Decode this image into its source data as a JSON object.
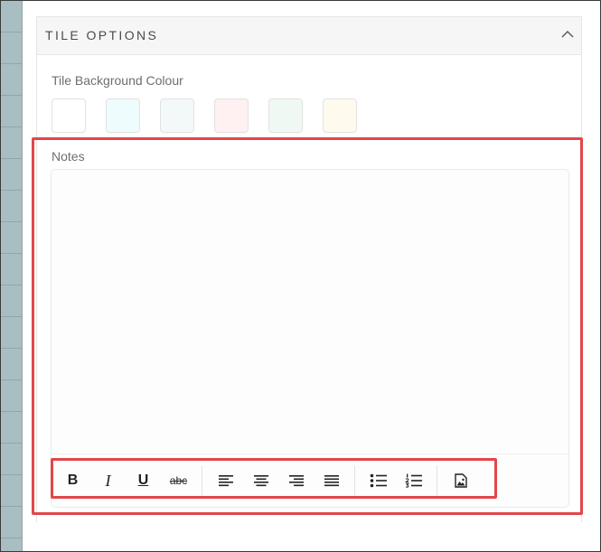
{
  "panel": {
    "title": "TILE OPTIONS",
    "collapse_icon": "chevron-up-icon"
  },
  "background": {
    "label": "Tile Background Colour",
    "swatches": [
      {
        "name": "white",
        "color": "#ffffff"
      },
      {
        "name": "light-cyan",
        "color": "#eefcfd"
      },
      {
        "name": "light-grey-teal",
        "color": "#f3f9f8"
      },
      {
        "name": "light-pink",
        "color": "#fff0f1"
      },
      {
        "name": "light-mint",
        "color": "#f0f8f4"
      },
      {
        "name": "light-cream",
        "color": "#fffaee"
      }
    ]
  },
  "notes": {
    "label": "Notes",
    "toolbar": {
      "bold": "B",
      "italic": "I",
      "underline": "U",
      "strikethrough": "abc"
    }
  },
  "colors": {
    "highlight": "#e2464a",
    "strip": "#a9bec3"
  }
}
